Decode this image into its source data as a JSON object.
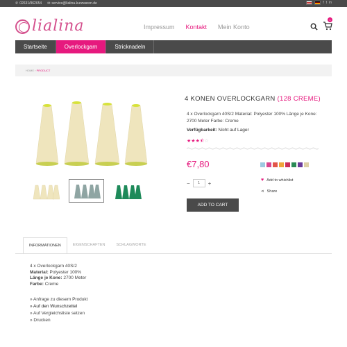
{
  "topbar": {
    "phone": "02631/962654",
    "email": "service@lialina-kurzwaren.de",
    "social": [
      "f",
      "t",
      "in"
    ]
  },
  "logo": {
    "text": "lialina"
  },
  "nav_top": [
    "Impressum",
    "Kontakt",
    "Mein Konto"
  ],
  "cart": {
    "count": "1"
  },
  "menu": [
    "Startseite",
    "Overlockgarn",
    "Stricknadeln"
  ],
  "breadcrumb": {
    "home": "HOME",
    "sep": " › ",
    "current": "PRODUCT"
  },
  "product": {
    "title_main": "4 KONEN OVERLOCKGARN",
    "title_color": "(128 CREME)",
    "description": "4 x Overlockgarn 40S/2 Material: Polyester 100% Länge je Kone: 2700 Meter Farbe: Creme",
    "availability_label": "Verfügbarkeit:",
    "availability_value": "Nicht auf Lager",
    "rating": 3.5,
    "price": "€7,80",
    "quantity": "1",
    "wishlist_label": "Add to whishlist",
    "share_label": "Share",
    "add_to_cart": "ADD TO CART",
    "swatch_colors": [
      "#9ec9e0",
      "#d9458f",
      "#e2554a",
      "#f0a53b",
      "#cc2d5a",
      "#2a8a56",
      "#6a3a9a",
      "#ddd0a5"
    ]
  },
  "tabs": [
    "INFORMATIONEN",
    "EIGENSCHAFTEN",
    "SCHLAGWORTE"
  ],
  "info": {
    "line1": "4 x Overlockgarn 40S/2",
    "material_label": "Material:",
    "material_value": "Polyester 100%",
    "length_label": "Länge je Kone:",
    "length_value": "2700 Meter",
    "color_label": "Farbe:",
    "color_value": "Creme"
  },
  "links": [
    "» Anfrage zu diesem Produkt",
    "» Auf den Wunschzettel",
    "» Auf Vergleichsliste setzen",
    "» Drucken"
  ],
  "colors": {
    "accent": "#e6197e",
    "dark": "#4a4a4a",
    "thread_cream": "#efe5bd",
    "thread_grey": "#8fa5a3",
    "thread_green": "#1e8a5a"
  }
}
